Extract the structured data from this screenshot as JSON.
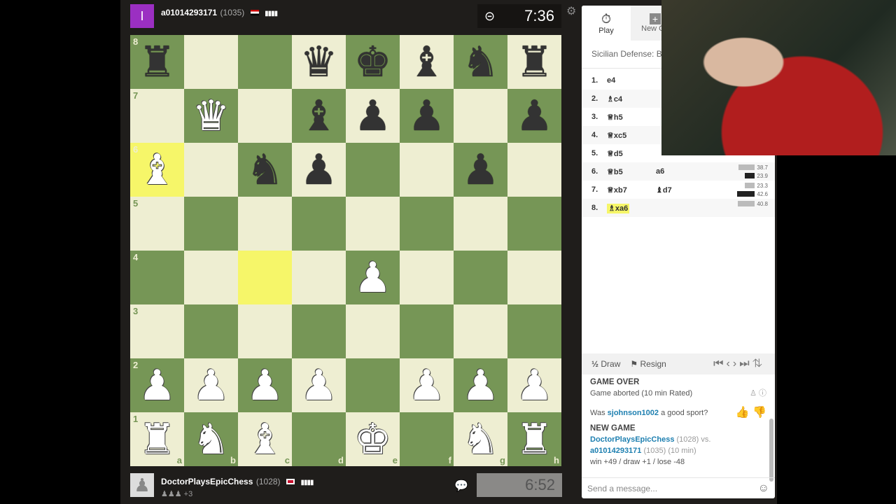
{
  "top_player": {
    "avatar_letter": "I",
    "avatar_color": "#9b2fc2",
    "name": "a01014293171",
    "rating": "(1035)",
    "clock": "7:36"
  },
  "bottom_player": {
    "name": "DoctorPlaysEpicChess",
    "rating": "(1028)",
    "material": "+3",
    "clock": "6:52"
  },
  "board": {
    "colors": {
      "light": "#eeeed2",
      "dark": "#769656",
      "highlight": "#f6f669"
    },
    "highlighted": [
      "a6",
      "c4"
    ],
    "pieces": {
      "a8": "bR",
      "d8": "bQ",
      "e8": "bK",
      "f8": "bB",
      "g8": "bN",
      "h8": "bR",
      "b7": "wQ",
      "d7": "bB",
      "e7": "bP",
      "f7": "bP",
      "h7": "bP",
      "a6": "wB",
      "c6": "bN",
      "d6": "bP",
      "g6": "bP",
      "e4": "wP",
      "a2": "wP",
      "b2": "wP",
      "c2": "wP",
      "d2": "wP",
      "f2": "wP",
      "g2": "wP",
      "h2": "wP",
      "a1": "wR",
      "b1": "wN",
      "c1": "wB",
      "e1": "wK",
      "g1": "wN",
      "h1": "wR"
    }
  },
  "sidebar": {
    "tabs": [
      {
        "label": "Play",
        "icon": "stopwatch-icon"
      },
      {
        "label": "New Ga",
        "icon": "plus-icon"
      }
    ],
    "opening": "Sicilian Defense: Bow",
    "moves": [
      {
        "n": "1.",
        "w": "e4",
        "wp": "",
        "b": "",
        "bp": ""
      },
      {
        "n": "2.",
        "w": "c4",
        "wp": "♗",
        "b": "",
        "bp": ""
      },
      {
        "n": "3.",
        "w": "h5",
        "wp": "♕",
        "b": "",
        "bp": ""
      },
      {
        "n": "4.",
        "w": "xc5",
        "wp": "♕",
        "b": "",
        "bp": ""
      },
      {
        "n": "5.",
        "w": "d5",
        "wp": "♕",
        "b": "",
        "bp": ""
      },
      {
        "n": "6.",
        "w": "b5",
        "wp": "♕",
        "b": "a6",
        "bp": ""
      },
      {
        "n": "7.",
        "w": "xb7",
        "wp": "♕",
        "b": "d7",
        "bp": "♝"
      },
      {
        "n": "8.",
        "w": "xa6",
        "wp": "♗",
        "b": "",
        "bp": "",
        "current": true
      }
    ],
    "evals": [
      {
        "move": 6,
        "white": 38.7,
        "black": 23.9
      },
      {
        "move": 7,
        "white": 23.3,
        "black": 42.6
      },
      {
        "move": 8,
        "white": 40.8
      }
    ],
    "controls": {
      "draw": "Draw",
      "draw_symbol": "½",
      "resign": "Resign"
    },
    "chat": {
      "game_over": "GAME OVER",
      "aborted": "Game aborted (10 min Rated)",
      "sport_pre": "Was ",
      "sport_user": "sjohnson1002",
      "sport_post": " a good sport?",
      "new_game": "NEW GAME",
      "p1": "DoctorPlaysEpicChess",
      "p1r": " (1028) vs.",
      "p2": "a01014293171",
      "p2r": " (1035) (10 min)",
      "stakes": "win +49 / draw +1 / lose -48"
    },
    "message_placeholder": "Send a message..."
  }
}
